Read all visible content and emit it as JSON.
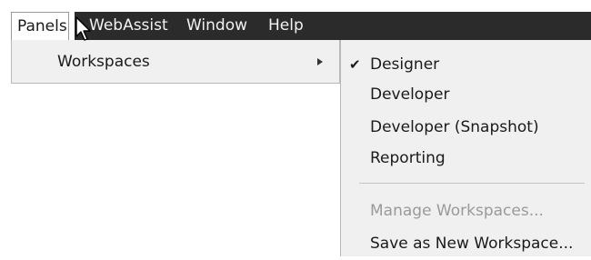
{
  "menubar": {
    "items": [
      {
        "label": "Panels"
      },
      {
        "label": "WebAssist"
      },
      {
        "label": "Window"
      },
      {
        "label": "Help"
      }
    ]
  },
  "panels_menu": {
    "items": [
      {
        "label": "Workspaces",
        "has_submenu": true
      }
    ]
  },
  "workspaces_submenu": {
    "items": [
      {
        "label": "Designer",
        "checked": true,
        "enabled": true
      },
      {
        "label": "Developer",
        "checked": false,
        "enabled": true
      },
      {
        "label": "Developer (Snapshot)",
        "checked": false,
        "enabled": true
      },
      {
        "label": "Reporting",
        "checked": false,
        "enabled": true
      },
      {
        "label": "Manage Workspaces...",
        "checked": false,
        "enabled": false
      },
      {
        "label": "Save as New Workspace...",
        "checked": false,
        "enabled": true
      }
    ],
    "check_glyph": "✔"
  },
  "colors": {
    "menubar_bg": "#2b2b2b",
    "menu_bg": "#f0f0f0",
    "disabled_text": "#9a9a9a"
  },
  "icons": {
    "cursor": "mouse-pointer-icon",
    "submenu_arrow": "chevron-right-icon",
    "check": "checkmark-icon"
  }
}
